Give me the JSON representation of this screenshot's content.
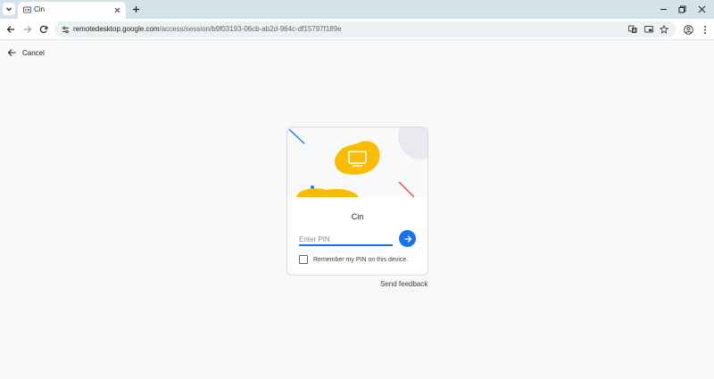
{
  "browser": {
    "tab": {
      "title": "Cin",
      "favicon": "remote-desktop-favicon"
    },
    "new_tab_icon": "plus-icon",
    "url": {
      "host": "remotedesktop.google.com",
      "path": "/access/session/b9f03193-06cb-ab2d-964c-df15797f189e"
    },
    "colors": {
      "tabstrip": "#d3e3e9",
      "omnibox": "#ecf1f3"
    }
  },
  "page": {
    "cancel_label": "Cancel",
    "device_name": "Cin",
    "pin_placeholder": "Enter PIN",
    "remember_label": "Remember my PIN on this device.",
    "feedback_label": "Send feedback",
    "colors": {
      "accent": "#1a73e8",
      "hero_blob": "#fbbc04",
      "hero_line_red": "#ea4335",
      "hero_line_blue": "#1a73e8"
    }
  }
}
